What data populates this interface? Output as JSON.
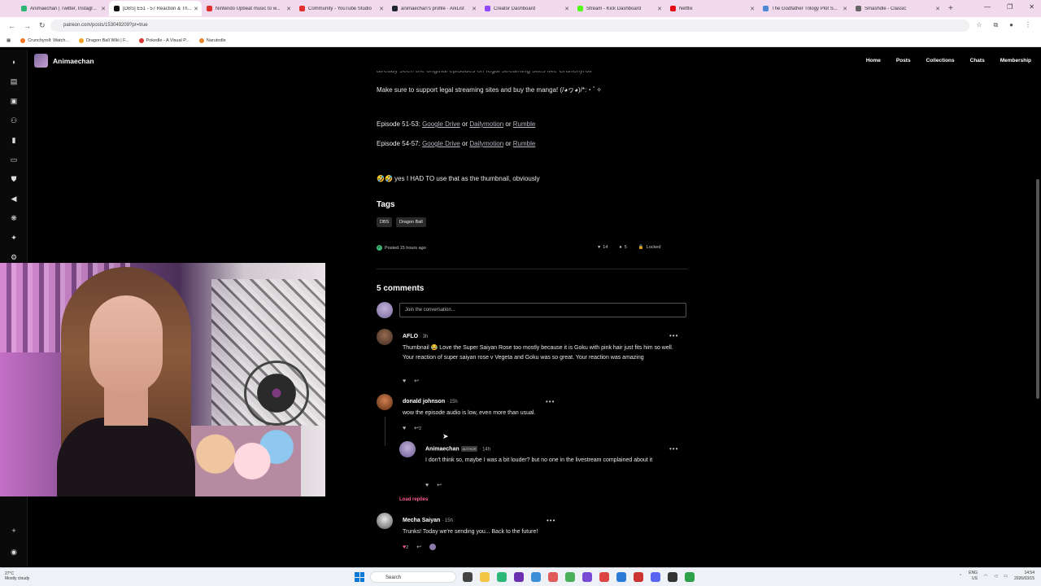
{
  "browser": {
    "tabs": [
      {
        "label": "Animaechan | Twitter, Instagr...",
        "color": "#2bb673",
        "active": false
      },
      {
        "label": "[DBS] E51 - 57 Reaction & Th...",
        "color": "#111111",
        "active": true
      },
      {
        "label": "Nintendo Upbeat music to w...",
        "color": "#e02f2f",
        "active": false
      },
      {
        "label": "Community - YouTube Studio",
        "color": "#e02f2f",
        "active": false
      },
      {
        "label": "animaechan's profile · AniList",
        "color": "#1f2631",
        "active": false
      },
      {
        "label": "Creator Dashboard",
        "color": "#9146ff",
        "active": false
      },
      {
        "label": "Stream - Kick Dashboard",
        "color": "#53fc18",
        "active": false
      },
      {
        "label": "Netflix",
        "color": "#e50914",
        "active": false
      },
      {
        "label": "The Godfather Trilogy Plot S...",
        "color": "#4a8ad8",
        "active": false
      },
      {
        "label": "Smashdle - Classic",
        "color": "#666666",
        "active": false
      }
    ],
    "url": "patreon.com/posts/153049209?pr=true",
    "bookmarks": [
      {
        "label": "Crunchyroll: Watch...",
        "color": "#f47521"
      },
      {
        "label": "Dragon Ball Wiki | F...",
        "color": "#f0a020"
      },
      {
        "label": "Pokedle - A Visual P...",
        "color": "#d33"
      },
      {
        "label": "Narutodle",
        "color": "#e8842a"
      }
    ]
  },
  "patreon": {
    "creator_name": "Animaechan",
    "nav": [
      "Home",
      "Posts",
      "Collections",
      "Chats",
      "Membership"
    ],
    "post": {
      "cutoff_line": "already seen the original episodes on legal streaming sites like Crunchyroll",
      "support_line": "Make sure to support legal streaming sites and buy the manga! (/◕ヮ◕)/*:・ﾟ✧",
      "episodes_51": {
        "label": "Episode 51-53:",
        "links": [
          "Google Drive",
          "Dailymotion",
          "Rumble"
        ],
        "sep": "or"
      },
      "episodes_54": {
        "label": "Episode 54-57:",
        "links": [
          "Google Drive",
          "Dailymotion",
          "Rumble"
        ],
        "sep": "or"
      },
      "thumbnail_line": "yes I HAD TO use that as the thumbnail, obviously",
      "tags_title": "Tags",
      "tags": [
        "DBS",
        "Dragon Ball"
      ],
      "posted": "Posted 15 hours ago",
      "likes": "14",
      "comments_count": "5",
      "locked": "Locked"
    },
    "comments_title": "5 comments",
    "join_placeholder": "Join the conversation...",
    "comments": [
      {
        "name": "AFLO",
        "time": "· 3h",
        "text": "Thumbnail 😂 Love the Super Saiyan Rose too mostly because it is Goku with pink hair just fits him so well. Your reaction of super saiyan rose v Vegeta and Goku was so great. Your reaction was amazing",
        "replies": ""
      },
      {
        "name": "donald johnson",
        "time": "· 15h",
        "text": "wow the episode audio is low, even more than usual.",
        "replies": "2"
      },
      {
        "name": "Animaechan",
        "badge": "AUTHOR",
        "time": "· 14h",
        "text": "I don't think so, maybe I was a bit louder? but no one in the livestream complained about it",
        "replies": ""
      },
      {
        "name": "Mecha Saiyan",
        "time": "· 15h",
        "text": "Trunks! Today we're sending you... Back to the future!",
        "likes": "2"
      }
    ],
    "load_replies": "Load replies"
  },
  "taskbar": {
    "weather_temp": "27°C",
    "weather_desc": "Mostly cloudy",
    "search": "Search",
    "lang": "ENG",
    "region": "US",
    "time": "14:54",
    "date": "2026/03/15"
  },
  "colors": {
    "accent_pink": "#ff5d8f",
    "link_gray": "#b5b5c5",
    "patreon_bg": "#000000"
  }
}
